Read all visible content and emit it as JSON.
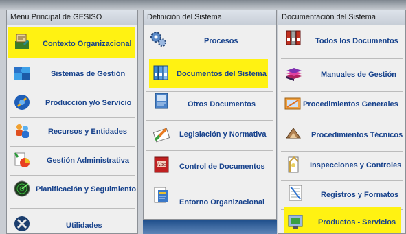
{
  "panels": [
    {
      "title": "Menu Principal de GESISO",
      "items": [
        {
          "label": "Contexto Organizacional",
          "icon": "org-context-icon",
          "highlighted": true
        },
        {
          "label": "Sistemas de Gestión",
          "icon": "puzzle-icon",
          "highlighted": false
        },
        {
          "label": "Producción y/o Servicio",
          "icon": "production-icon",
          "highlighted": false
        },
        {
          "label": "Recursos y Entidades",
          "icon": "people-icon",
          "highlighted": false
        },
        {
          "label": "Gestión Administrativa",
          "icon": "admin-chart-icon",
          "highlighted": false
        },
        {
          "label": "Planificación y Seguimiento",
          "icon": "radar-icon",
          "highlighted": false
        },
        {
          "label": "Utilidades",
          "icon": "tools-icon",
          "highlighted": false
        }
      ]
    },
    {
      "title": "Definición del Sistema",
      "items": [
        {
          "label": "Procesos",
          "icon": "gears-icon",
          "highlighted": false
        },
        {
          "label": "Documentos del Sistema",
          "icon": "binders-icon",
          "highlighted": true
        },
        {
          "label": "Otros Documentos",
          "icon": "document-icon",
          "highlighted": false
        },
        {
          "label": "Legislación y Normativa",
          "icon": "law-book-icon",
          "highlighted": false
        },
        {
          "label": "Control de Documentos",
          "icon": "abc-book-icon",
          "highlighted": false
        },
        {
          "label": "Entorno Organizacional",
          "icon": "environment-doc-icon",
          "highlighted": false
        }
      ]
    },
    {
      "title": "Documentación del Sistema",
      "items": [
        {
          "label": "Todos los Documentos",
          "icon": "all-binders-icon",
          "highlighted": false
        },
        {
          "label": "Manuales de Gestión",
          "icon": "books-stack-icon",
          "highlighted": false
        },
        {
          "label": "Procedimientos Generales",
          "icon": "procedure-icon",
          "highlighted": false
        },
        {
          "label": "Procedimientos Técnicos",
          "icon": "technical-tools-icon",
          "highlighted": false
        },
        {
          "label": "Inspecciones y Controles",
          "icon": "inspection-icon",
          "highlighted": false
        },
        {
          "label": "Registros y Formatos",
          "icon": "records-icon",
          "highlighted": false
        },
        {
          "label": "Productos - Servicios",
          "icon": "products-icon",
          "highlighted": true
        }
      ]
    }
  ],
  "colors": {
    "highlight": "#fff212",
    "label": "#17428c"
  }
}
